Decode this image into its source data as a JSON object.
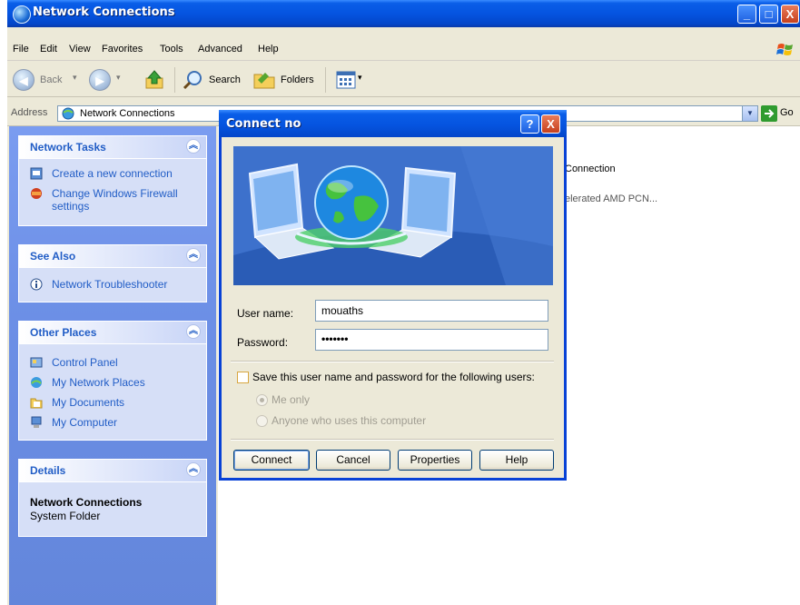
{
  "window": {
    "title": "Network Connections",
    "min_label": "_",
    "max_label": "□",
    "close_label": "X"
  },
  "menu": [
    "File",
    "Edit",
    "View",
    "Favorites",
    "Tools",
    "Advanced",
    "Help"
  ],
  "toolbar": {
    "back_label": "Back",
    "search_label": "Search",
    "folders_label": "Folders"
  },
  "address": {
    "label": "Address",
    "value": "Network Connections",
    "go_label": "Go"
  },
  "tasks": {
    "network_tasks": {
      "title": "Network Tasks",
      "items": [
        "Create a new connection",
        "Change Windows Firewall",
        "settings"
      ]
    },
    "see_also": {
      "title": "See Also",
      "items": [
        "Network Troubleshooter"
      ]
    },
    "other_places": {
      "title": "Other Places",
      "items": [
        "Control Panel",
        "My Network Places",
        "My Documents",
        "My Computer"
      ]
    },
    "details": {
      "title": "Details",
      "name": "Network Connections",
      "type": "System Folder"
    }
  },
  "content": {
    "line1": "Connection",
    "line2": "elerated AMD PCN..."
  },
  "dialog": {
    "title": "Connect no",
    "help_label": "?",
    "close_label": "X",
    "username_label": "User name:",
    "username_value": "mouaths",
    "password_label": "Password:",
    "password_value": "•••••••",
    "save_label": "Save this user name and password for the following users:",
    "me_only_label": "Me only",
    "anyone_label": "Anyone who uses this computer",
    "buttons": {
      "connect": "Connect",
      "cancel": "Cancel",
      "properties": "Properties",
      "help": "Help"
    }
  },
  "colors": {
    "titlebar": "#0554e0",
    "pane": "#6c8fe6",
    "link": "#215dc6"
  }
}
